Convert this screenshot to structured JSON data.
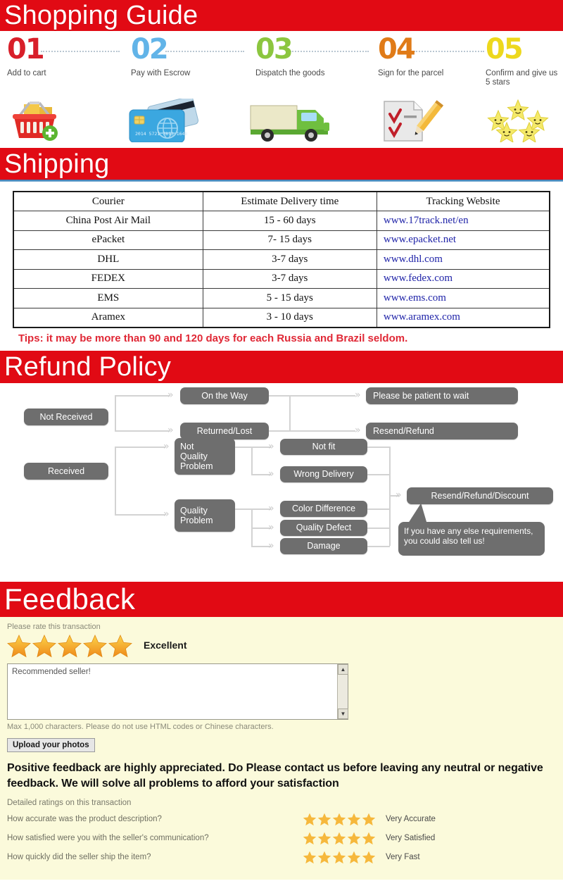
{
  "banners": {
    "guide": "Shopping Guide",
    "shipping": "Shipping",
    "refund": "Refund Policy",
    "feedback": "Feedback"
  },
  "colors": {
    "banner_red": "#e10a14",
    "tips_red": "#e02836",
    "link_blue": "#1f23a8",
    "flow_gray": "#6e6e6e",
    "feedback_bg": "#fbfadb",
    "star_orange": "#f59a1e"
  },
  "guide_steps": [
    {
      "number": "01",
      "label": "Add to cart",
      "icon": "shopping-basket-icon",
      "color": "#d81f2a"
    },
    {
      "number": "02",
      "label": "Pay with Escrow",
      "icon": "credit-card-icon",
      "color": "#62b4e8"
    },
    {
      "number": "03",
      "label": "Dispatch the goods",
      "icon": "delivery-truck-icon",
      "color": "#8cc63f"
    },
    {
      "number": "04",
      "label": "Sign for the parcel",
      "icon": "sign-document-icon",
      "color": "#e07b18"
    },
    {
      "number": "05",
      "label": "Confirm and give us 5 stars",
      "icon": "five-stars-icon",
      "color": "#edd81d"
    }
  ],
  "shipping_table": {
    "headers": [
      "Courier",
      "Estimate Delivery time",
      "Tracking Website"
    ],
    "rows": [
      {
        "courier": "China Post Air Mail",
        "time": "15 - 60 days",
        "url": "www.17track.net/en"
      },
      {
        "courier": "ePacket",
        "time": "7- 15 days",
        "url": "www.epacket.net"
      },
      {
        "courier": "DHL",
        "time": "3-7 days",
        "url": "www.dhl.com"
      },
      {
        "courier": "FEDEX",
        "time": "3-7 days",
        "url": "www.fedex.com"
      },
      {
        "courier": "EMS",
        "time": "5 - 15 days",
        "url": "www.ems.com"
      },
      {
        "courier": "Aramex",
        "time": "3 - 10 days",
        "url": "www.aramex.com"
      }
    ],
    "tips": "Tips: it may be more than 90 and 120 days for each Russia and Brazil seldom."
  },
  "refund_flow": {
    "not_received": "Not Received",
    "on_the_way": "On the Way",
    "returned_lost": "Returned/Lost",
    "be_patient": "Please be patient to wait",
    "resend_refund": "Resend/Refund",
    "received": "Received",
    "not_quality_problem": "Not\nQuality\nProblem",
    "quality_problem": "Quality\nProblem",
    "not_fit": "Not fit",
    "wrong_delivery": "Wrong Delivery",
    "color_difference": "Color Difference",
    "quality_defect": "Quality Defect",
    "damage": "Damage",
    "resend_refund_discount": "Resend/Refund/Discount",
    "callout": "If you have any else requirements, you could also tell us!"
  },
  "feedback": {
    "rate_prompt": "Please rate this transaction",
    "rating_word": "Excellent",
    "rating_stars": 5,
    "comment_value": "Recommended seller!",
    "max_chars_note": "Max 1,000 characters. Please do not use HTML codes or Chinese characters.",
    "upload_button": "Upload your photos",
    "positive_note": "Positive feedback are highly appreciated. Do Please contact us before leaving any neutral or negative feedback. We will solve all problems to afford your satisfaction",
    "detailed_header": "Detailed ratings on this transaction",
    "detailed_rows": [
      {
        "question": "How accurate was the product description?",
        "stars": 5,
        "word": "Very Accurate"
      },
      {
        "question": "How satisfied were you with the seller's communication?",
        "stars": 5,
        "word": "Very Satisfied"
      },
      {
        "question": "How quickly did the seller ship the item?",
        "stars": 5,
        "word": "Very Fast"
      }
    ]
  }
}
